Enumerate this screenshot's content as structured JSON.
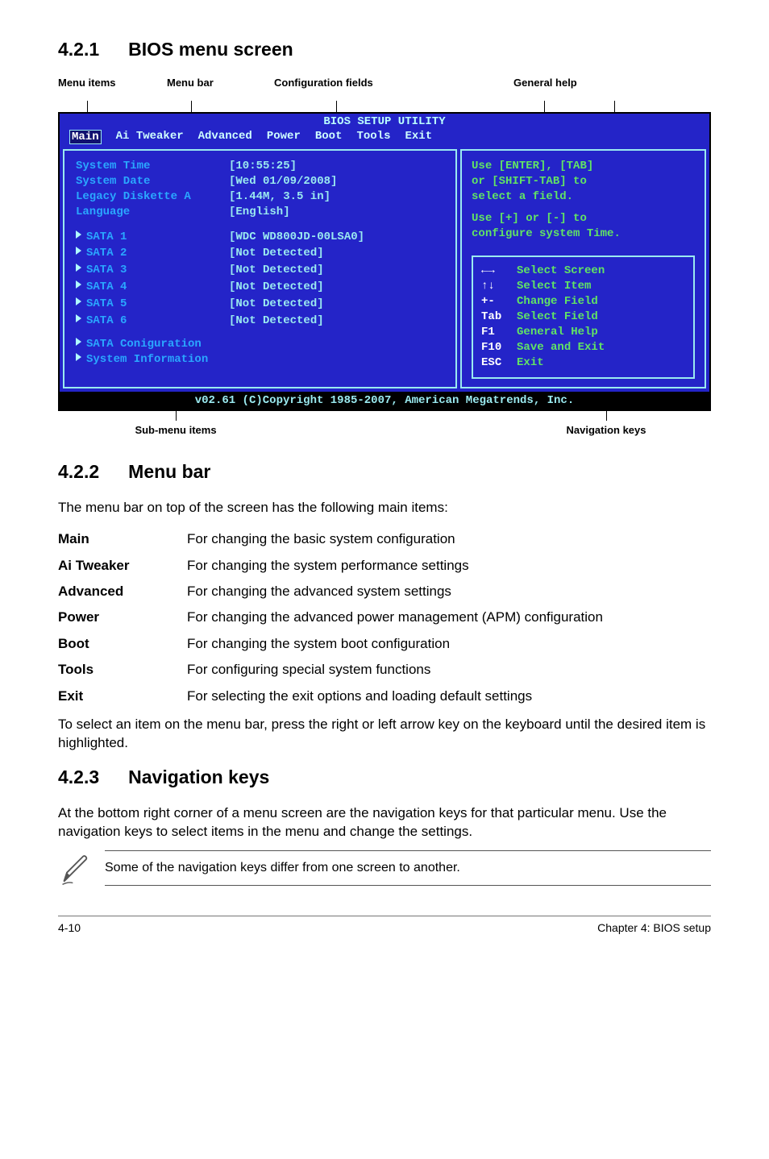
{
  "sec421_num": "4.2.1",
  "sec421_title": "BIOS menu screen",
  "labels": {
    "menu_items": "Menu items",
    "menu_bar": "Menu bar",
    "config_fields": "Configuration fields",
    "general_help": "General help",
    "sub_menu": "Sub-menu items",
    "nav_keys": "Navigation keys"
  },
  "bios": {
    "title": "BIOS SETUP UTILITY",
    "tabs": {
      "main": "Main",
      "ai": "Ai Tweaker",
      "advanced": "Advanced",
      "power": "Power",
      "boot": "Boot",
      "tools": "Tools",
      "exit": "Exit"
    },
    "fields": {
      "system_time": {
        "label": "System Time",
        "value": "[10:55:25]"
      },
      "system_date": {
        "label": "System Date",
        "value": "[Wed 01/09/2008]"
      },
      "legacy": {
        "label": "Legacy Diskette A",
        "value": "[1.44M, 3.5 in]"
      },
      "language": {
        "label": "Language",
        "value": "[English]"
      }
    },
    "sata": [
      {
        "label": "SATA 1",
        "value": "[WDC WD800JD-00LSA0]"
      },
      {
        "label": "SATA 2",
        "value": "[Not Detected]"
      },
      {
        "label": "SATA 3",
        "value": "[Not Detected]"
      },
      {
        "label": "SATA 4",
        "value": "[Not Detected]"
      },
      {
        "label": "SATA 5",
        "value": "[Not Detected]"
      },
      {
        "label": "SATA 6",
        "value": "[Not Detected]"
      }
    ],
    "subs": {
      "sata_conf": "SATA Coniguration",
      "sys_info": "System Information"
    },
    "help": {
      "l1": "Use [ENTER], [TAB]",
      "l2": "or [SHIFT-TAB] to",
      "l3": "select a field.",
      "l4": "Use [+] or [-] to",
      "l5": "configure system Time."
    },
    "nav": [
      {
        "key": "←→",
        "desc": "Select Screen"
      },
      {
        "key": "↑↓",
        "desc": "Select Item"
      },
      {
        "key": "+-",
        "desc": "Change Field"
      },
      {
        "key": "Tab",
        "desc": "Select Field"
      },
      {
        "key": "F1",
        "desc": "General Help"
      },
      {
        "key": "F10",
        "desc": "Save and Exit"
      },
      {
        "key": "ESC",
        "desc": "Exit"
      }
    ],
    "footer": "v02.61 (C)Copyright 1985-2007, American Megatrends, Inc."
  },
  "sec422_num": "4.2.2",
  "sec422_title": "Menu bar",
  "sec422_intro": "The menu bar on top of the screen has the following main items:",
  "menu_desc": {
    "main": {
      "k": "Main",
      "v": "For changing the basic system configuration"
    },
    "ai": {
      "k": "Ai Tweaker",
      "v": "For changing the system performance settings"
    },
    "advanced": {
      "k": "Advanced",
      "v": "For changing the advanced system settings"
    },
    "power": {
      "k": "Power",
      "v": "For changing the advanced power management (APM) configuration"
    },
    "boot": {
      "k": "Boot",
      "v": "For changing the system boot configuration"
    },
    "tools": {
      "k": "Tools",
      "v": "For configuring special system functions"
    },
    "exit": {
      "k": "Exit",
      "v": "For selecting the exit options and loading default settings"
    }
  },
  "sec422_foot": "To select an item on the menu bar, press the right or left arrow key on the keyboard until the desired item is highlighted.",
  "sec423_num": "4.2.3",
  "sec423_title": "Navigation keys",
  "sec423_body": "At the bottom right corner of a menu screen are the navigation keys for that particular menu. Use the navigation keys to select items in the menu and change the settings.",
  "note": "Some of the navigation keys differ from one screen to another.",
  "footer_left": "4-10",
  "footer_right": "Chapter 4: BIOS setup"
}
